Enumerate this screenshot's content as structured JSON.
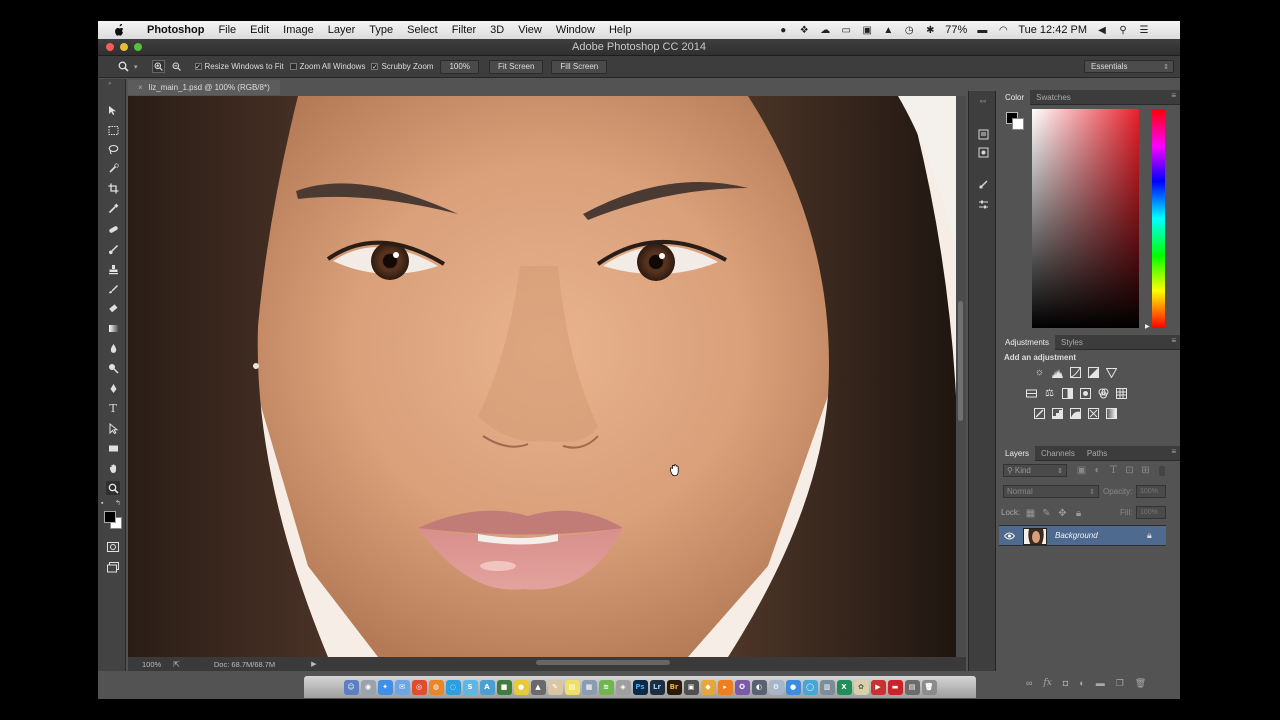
{
  "menubar": {
    "items": [
      "Photoshop",
      "File",
      "Edit",
      "Image",
      "Layer",
      "Type",
      "Select",
      "Filter",
      "3D",
      "View",
      "Window",
      "Help"
    ],
    "battery": "77%",
    "clock": "Tue 12:42 PM"
  },
  "window": {
    "title": "Adobe Photoshop CC 2014"
  },
  "options": {
    "resize_windows": "Resize Windows to Fit",
    "zoom_all": "Zoom All Windows",
    "scrubby_zoom": "Scrubby Zoom",
    "zoom_btn": "100%",
    "fit_screen": "Fit Screen",
    "fill_screen": "Fill Screen",
    "workspace": "Essentials"
  },
  "document": {
    "tab": "liz_main_1.psd @ 100% (RGB/8*)",
    "zoom": "100%",
    "doc_size": "Doc: 68.7M/68.7M"
  },
  "color_panel": {
    "tabs": [
      "Color",
      "Swatches"
    ]
  },
  "adjustments_panel": {
    "tabs": [
      "Adjustments",
      "Styles"
    ],
    "heading": "Add an adjustment"
  },
  "layers_panel": {
    "tabs": [
      "Layers",
      "Channels",
      "Paths"
    ],
    "filter": "Kind",
    "blend_mode": "Normal",
    "opacity_label": "Opacity:",
    "opacity_value": "100%",
    "lock_label": "Lock:",
    "fill_label": "Fill:",
    "fill_value": "100%",
    "layers": [
      {
        "name": "Background"
      }
    ]
  },
  "colors": {
    "foreground": "#000000",
    "background": "#ffffff",
    "ui_dark": "#535353",
    "selected_layer": "#4e6a8e"
  }
}
